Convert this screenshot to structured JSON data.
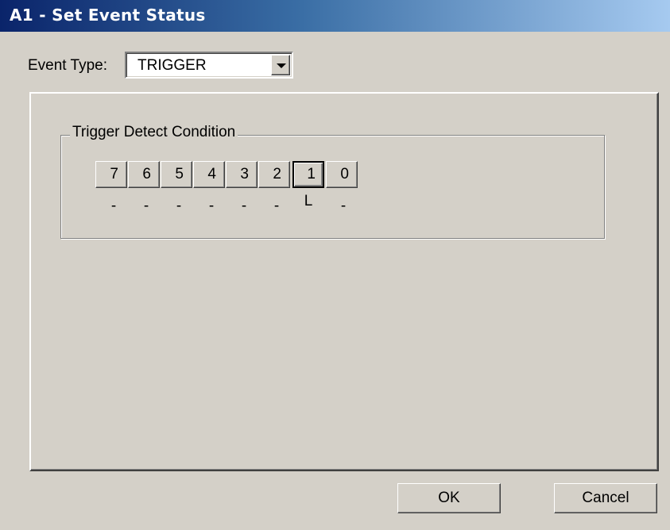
{
  "window": {
    "title": "A1 - Set Event Status"
  },
  "event_type": {
    "label": "Event Type:",
    "selected": "TRIGGER"
  },
  "group": {
    "title": "Trigger Detect Condition"
  },
  "bits": [
    {
      "label": "7",
      "value": "-"
    },
    {
      "label": "6",
      "value": "-"
    },
    {
      "label": "5",
      "value": "-"
    },
    {
      "label": "4",
      "value": "-"
    },
    {
      "label": "3",
      "value": "-"
    },
    {
      "label": "2",
      "value": "-"
    },
    {
      "label": "1",
      "value": "L",
      "focused": true
    },
    {
      "label": "0",
      "value": "-"
    }
  ],
  "buttons": {
    "ok": "OK",
    "cancel": "Cancel"
  },
  "colors": {
    "face": "#d4d0c8",
    "title_start": "#0a246a",
    "title_end": "#a6caf0"
  }
}
